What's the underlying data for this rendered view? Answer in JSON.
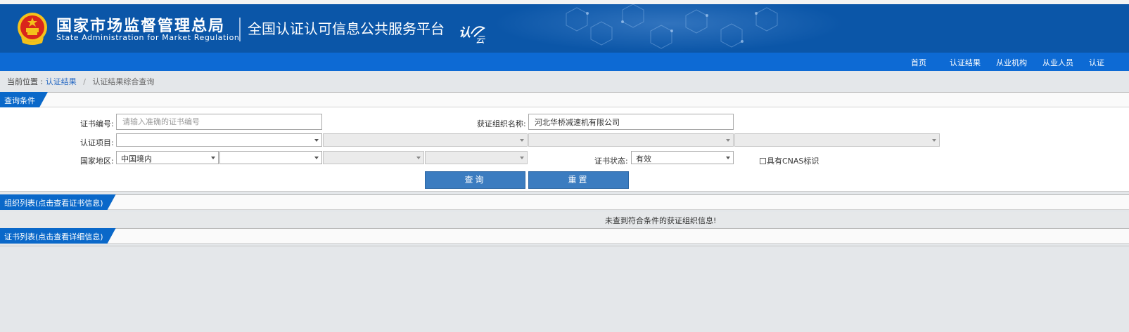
{
  "header": {
    "title_cn": "国家市场监督管理总局",
    "title_en": "State Administration  for  Market Regulation",
    "platform_title": "全国认证认可信息公共服务平台",
    "logo_text": "认云"
  },
  "nav": {
    "items": [
      {
        "label": "首页"
      },
      {
        "label": "认证结果"
      },
      {
        "label": "从业机构"
      },
      {
        "label": "从业人员"
      },
      {
        "label": "认证"
      }
    ]
  },
  "breadcrumb": {
    "prefix": "当前位置 :",
    "link": "认证结果",
    "separator": "/",
    "current": "认证结果综合查询"
  },
  "query": {
    "section_title": "查询条件",
    "cert_no": {
      "label": "证书编号:",
      "value": "",
      "placeholder": "请输入准确的证书编号"
    },
    "org_name": {
      "label": "获证组织名称:",
      "value": "河北华桥减速机有限公司"
    },
    "cert_item": {
      "label": "认证项目:",
      "selects": [
        "",
        "",
        "",
        ""
      ]
    },
    "region": {
      "label": "国家地区:",
      "selects": [
        "中国境内",
        "",
        "",
        ""
      ]
    },
    "status": {
      "label": "证书状态:",
      "value": "有效"
    },
    "cnas": {
      "label": "具有CNAS标识"
    },
    "search_button": "查询",
    "reset_button": "重置"
  },
  "org_list": {
    "title": "组织列表(点击查看证书信息)",
    "empty_message": "未查到符合条件的获证组织信息!"
  },
  "cert_list": {
    "title": "证书列表(点击查看详细信息)"
  },
  "colors": {
    "header_bg": "#0b56a8",
    "nav_bg": "#0d6ad4",
    "tab_bg": "#0a68c9",
    "button_bg": "#3b7cc0",
    "page_bg": "#e4e7ea",
    "link": "#2b6cc4"
  }
}
